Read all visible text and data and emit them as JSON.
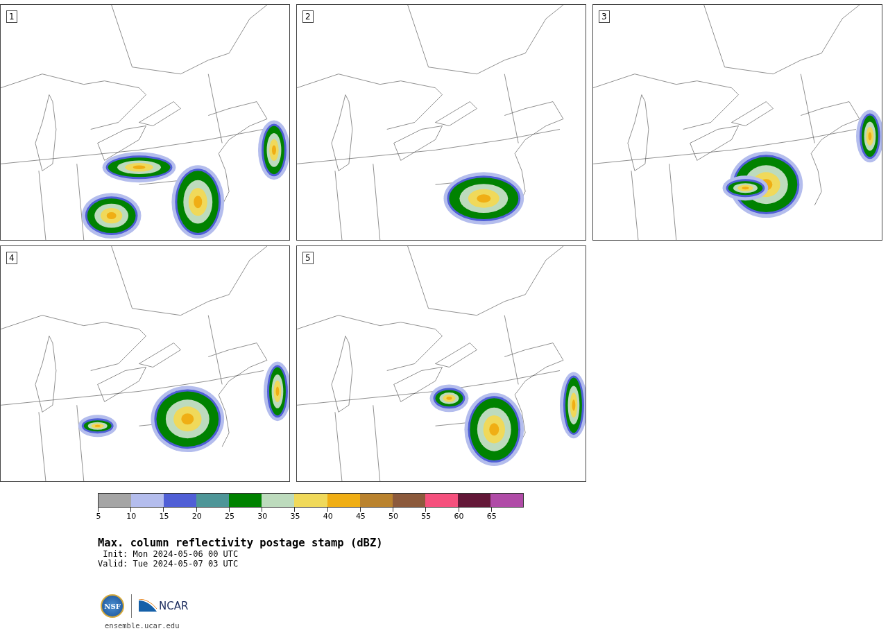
{
  "panels": [
    {
      "label": "1"
    },
    {
      "label": "2"
    },
    {
      "label": "3"
    },
    {
      "label": "4"
    },
    {
      "label": "5"
    }
  ],
  "colorbar": {
    "bins": [
      {
        "color": "#a5a5a5"
      },
      {
        "color": "#b4bded"
      },
      {
        "color": "#505fd6"
      },
      {
        "color": "#4e9698"
      },
      {
        "color": "#008200"
      },
      {
        "color": "#bddbbd"
      },
      {
        "color": "#f0d95a"
      },
      {
        "color": "#f0ae14"
      },
      {
        "color": "#ba832e"
      },
      {
        "color": "#8c5a3c"
      },
      {
        "color": "#f5507d"
      },
      {
        "color": "#631838"
      },
      {
        "color": "#b04ba7"
      }
    ],
    "ticks": [
      "5",
      "10",
      "15",
      "20",
      "25",
      "30",
      "35",
      "40",
      "45",
      "50",
      "55",
      "60",
      "65"
    ]
  },
  "title": "Max. column reflectivity postage stamp (dBZ)",
  "init": " Init: Mon 2024-05-06 00 UTC",
  "valid": "Valid: Tue 2024-05-07 03 UTC",
  "logo": {
    "nsf": "NSF",
    "ncar": "NCAR"
  },
  "url": "ensemble.ucar.edu"
}
